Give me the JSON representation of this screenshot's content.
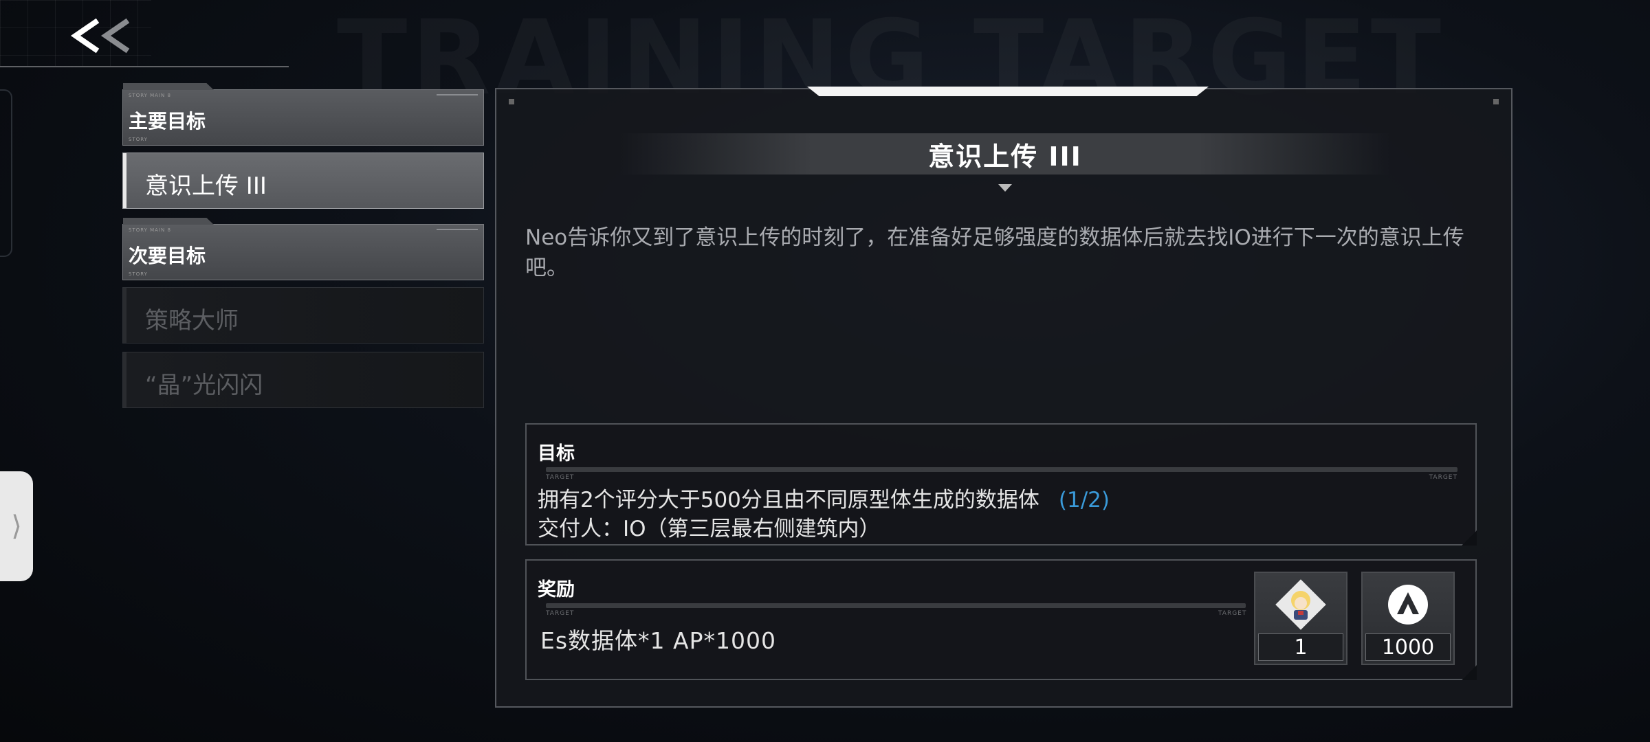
{
  "background_word": "TRAINING TARGET",
  "side_handle_glyph": "⟩",
  "sidebar": {
    "category_tiny_label": "STORY MAIN 8",
    "category_tiny_bottom": "STORY",
    "categories": [
      {
        "label": "主要目标",
        "quests": [
          {
            "label": "意识上传 III",
            "selected": true
          }
        ]
      },
      {
        "label": "次要目标",
        "quests": [
          {
            "label": "策略大师",
            "selected": false
          },
          {
            "label": "“晶”光闪闪",
            "selected": false
          }
        ]
      }
    ]
  },
  "panel": {
    "title": "意识上传 III",
    "description": "Neo告诉你又到了意识上传的时刻了，在准备好足够强度的数据体后就去找IO进行下一次的意识上传吧。",
    "goal": {
      "heading": "目标",
      "tiny_left": "TARGET",
      "tiny_right": "TARGET",
      "line1": "拥有2个评分大于500分且由不同原型体生成的数据体",
      "progress": "(1/2)",
      "line2": "交付人：IO（第三层最右侧建筑内）"
    },
    "reward": {
      "heading": "奖励",
      "tiny_left": "TARGET",
      "tiny_right": "TARGET",
      "text": "Es数据体*1  AP*1000",
      "items": [
        {
          "icon": "character-portrait-icon",
          "count": "1"
        },
        {
          "icon": "ap-logo-icon",
          "count": "1000"
        }
      ]
    }
  },
  "colors": {
    "progress": "#3a9ad9",
    "accent": "#f4f4f4"
  }
}
